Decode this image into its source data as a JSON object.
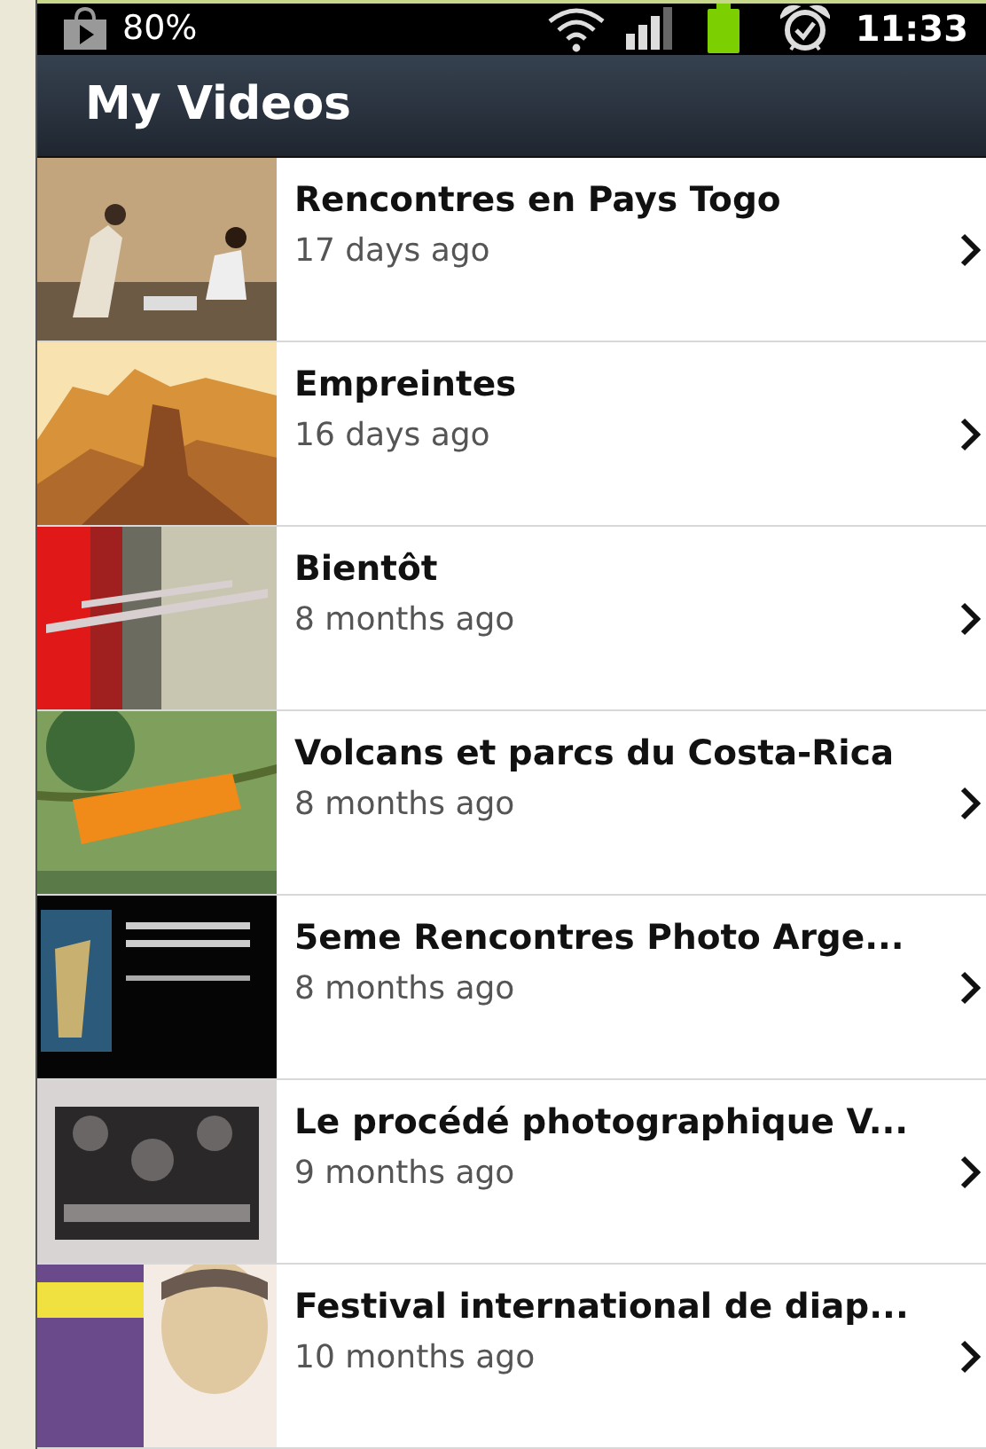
{
  "status_bar": {
    "battery_text": "80%",
    "time": "11:33"
  },
  "title_bar": {
    "title": "My Videos"
  },
  "videos": [
    {
      "title": "Rencontres en Pays Togo",
      "age": "17 days ago"
    },
    {
      "title": "Empreintes",
      "age": "16 days ago"
    },
    {
      "title": "Bientôt",
      "age": "8 months ago"
    },
    {
      "title": "Volcans et parcs du Costa-Rica",
      "age": "8 months ago"
    },
    {
      "title": "5eme Rencontres Photo Arge...",
      "age": "8 months ago"
    },
    {
      "title": "Le procédé photographique V...",
      "age": "9 months ago"
    },
    {
      "title": "Festival international de diap...",
      "age": "10 months ago"
    }
  ]
}
